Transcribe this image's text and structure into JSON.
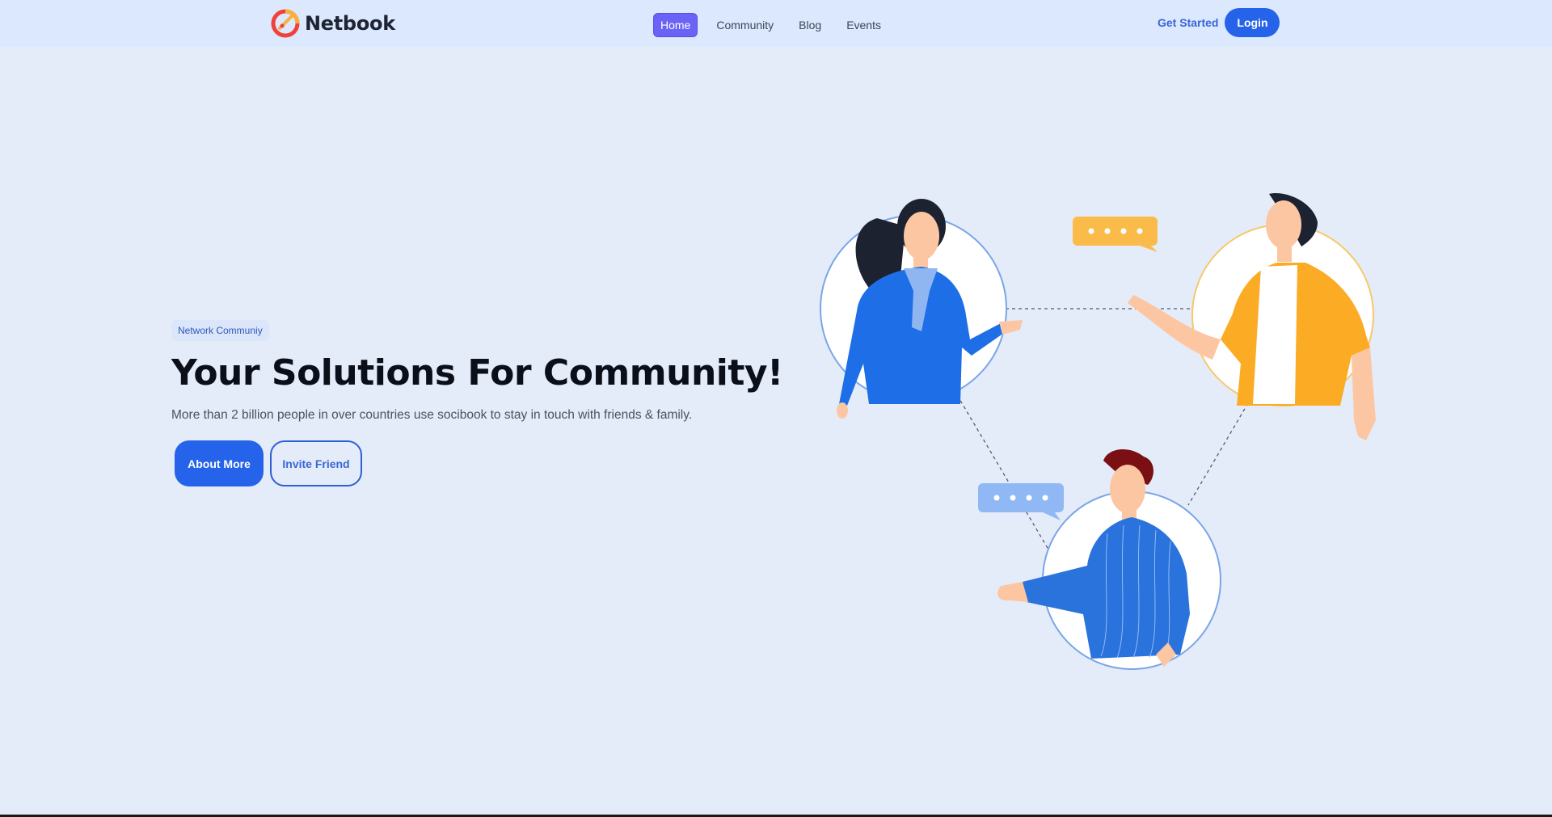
{
  "brand": {
    "name": "Netbook",
    "logo_icon": "netbook-logo-icon"
  },
  "nav": {
    "items": [
      {
        "label": "Home",
        "active": true
      },
      {
        "label": "Community",
        "active": false
      },
      {
        "label": "Blog",
        "active": false
      },
      {
        "label": "Events",
        "active": false
      }
    ],
    "get_started": "Get Started",
    "login": "Login"
  },
  "hero": {
    "badge": "Network Communiy",
    "title": "Your Solutions For Community!",
    "subtitle": "More than 2 billion people in over countries use socibook to stay in touch with friends & family.",
    "primary_button": "About More",
    "secondary_button": "Invite Friend"
  },
  "colors": {
    "page_bg": "#e4ecf9",
    "nav_bg": "#dbe8fd",
    "accent": "#2563eb",
    "active_nav": "#6b63f6",
    "orange": "#fbb03b",
    "blue_person": "#1a73e8"
  }
}
